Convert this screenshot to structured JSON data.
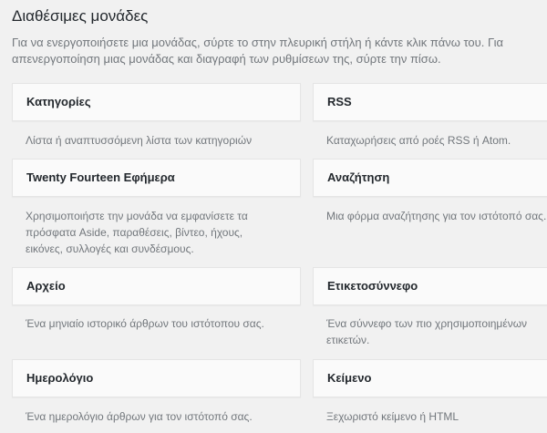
{
  "header": {
    "title": "Διαθέσιμες μονάδες",
    "description": "Για να ενεργοποιήσετε μια μονάδας, σύρτε το στην πλευρική στήλη ή κάντε κλικ πάνω του. Για απενεργοποίηση μιας μονάδας και διαγραφή των ρυθμίσεων της, σύρτε την πίσω."
  },
  "widgets": [
    {
      "title": "Κατηγορίες",
      "desc_lines": [
        "Λίστα ή αναπτυσσόμενη λίστα των κατηγοριών"
      ]
    },
    {
      "title": "RSS",
      "desc_lines": [
        "Καταχωρήσεις από ροές RSS ή Atom."
      ]
    },
    {
      "title": "Twenty Fourteen Εφήμερα",
      "desc_lines": [
        "Χρησιμοποιήστε την μονάδα να εμφανίσετε τα",
        "πρόσφατα Aside, παραθέσεις, βίντεο, ήχους,",
        "εικόνες, συλλογές και συνδέσμους."
      ]
    },
    {
      "title": "Αναζήτηση",
      "desc_lines": [
        "Μια φόρμα αναζήτησης για τον ιστότοπό σας."
      ]
    },
    {
      "title": "Αρχείο",
      "desc_lines": [
        "Ένα μηνιαίο ιστορικό άρθρων του ιστότοπου σας."
      ]
    },
    {
      "title": "Ετικετοσύννεφο",
      "desc_lines": [
        "Ένα σύννεφο των πιο χρησιμοποιημένων",
        "ετικετών."
      ]
    },
    {
      "title": "Ημερολόγιο",
      "desc_lines": [
        "Ένα ημερολόγιο άρθρων για τον ιστότοπό σας."
      ]
    },
    {
      "title": "Κείμενο",
      "desc_lines": [
        "Ξεχωριστό κείμενο ή HTML"
      ]
    }
  ]
}
